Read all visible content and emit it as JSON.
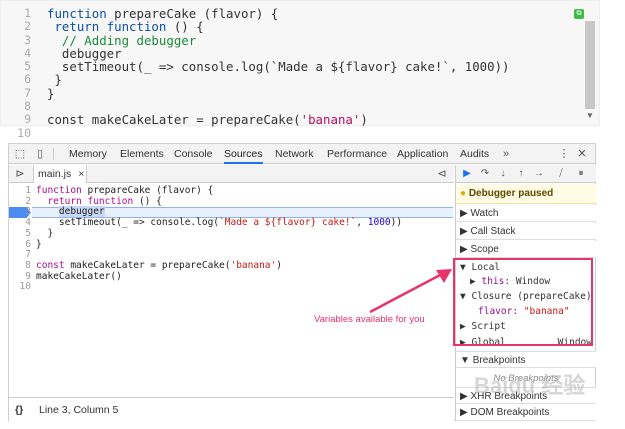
{
  "snippet": {
    "line_numbers": [
      "1",
      "2",
      "3",
      "4",
      "5",
      "6",
      "7",
      "8",
      "9",
      "10"
    ],
    "lines": [
      [
        [
          "kw",
          "function "
        ],
        [
          "tx",
          "prepareCake (flavor) {"
        ]
      ],
      [
        [
          "kw",
          " return function "
        ],
        [
          "tx",
          "() {"
        ]
      ],
      [
        [
          "cm",
          "  // Adding debugger"
        ]
      ],
      [
        [
          "tx",
          "  debugger"
        ]
      ],
      [
        [
          "tx",
          "  setTimeout(_ => console.log(`Made a ${flavor} cake!`, 1000))"
        ]
      ],
      [
        [
          "tx",
          " }"
        ]
      ],
      [
        [
          "tx",
          "}"
        ]
      ],
      [
        [
          "tx",
          ""
        ]
      ],
      [
        [
          "tx",
          "const makeCakeLater = prepareCake("
        ],
        [
          "str",
          "'banana'"
        ],
        [
          "tx",
          ")"
        ]
      ],
      [
        [
          "tx",
          ""
        ]
      ]
    ]
  },
  "toolbar": {
    "tabs": [
      "Memory",
      "Elements",
      "Console",
      "Sources",
      "Network",
      "Performance",
      "Application",
      "Audits"
    ],
    "active_tab": "Sources",
    "more": "»",
    "menu": "⋮",
    "close": "✕"
  },
  "sources": {
    "file_tab": "main.js",
    "file_close": "×",
    "editor_lines": [
      "1",
      "2",
      "3",
      "4",
      "5",
      "6",
      "7",
      "8",
      "9",
      "10"
    ],
    "code": [
      [
        [
          "kw",
          "function "
        ],
        [
          "tx",
          "prepareCake (flavor) {"
        ]
      ],
      [
        [
          "kw",
          "  return function "
        ],
        [
          "tx",
          "() {"
        ]
      ],
      [
        [
          "tx",
          "    debugger"
        ]
      ],
      [
        [
          "tx",
          "    setTimeout(_ => console.log("
        ],
        [
          "str",
          "`Made a ${flavor} cake!`"
        ],
        [
          "tx",
          ", "
        ],
        [
          "num",
          "1000"
        ],
        [
          "tx",
          "))"
        ]
      ],
      [
        [
          "tx",
          "  }"
        ]
      ],
      [
        [
          "tx",
          "}"
        ]
      ],
      [
        [
          "tx",
          ""
        ]
      ],
      [
        [
          "kw",
          "const "
        ],
        [
          "tx",
          "makeCakeLater = prepareCake("
        ],
        [
          "str",
          "'banana'"
        ],
        [
          "tx",
          ")"
        ]
      ],
      [
        [
          "tx",
          "makeCakeLater()"
        ]
      ],
      [
        [
          "tx",
          ""
        ]
      ]
    ],
    "status": "Line 3, Column 5",
    "status_icon": "{}"
  },
  "debugger": {
    "paused": "Debugger paused",
    "watch": "Watch",
    "call_stack": "Call Stack",
    "scope": "Scope",
    "local": "Local",
    "this_key": "this:",
    "this_val": "Window",
    "closure": "Closure (prepareCake)",
    "flavor_key": "flavor:",
    "flavor_val": "\"banana\"",
    "script": "Script",
    "global": "Global",
    "global_val": "Window",
    "breakpoints": "Breakpoints",
    "no_breakpoints": "No Breakpoints",
    "xhr": "XHR Breakpoints",
    "dom": "DOM Breakpoints"
  },
  "annotation": {
    "callout": "Variables available for you"
  },
  "watermark": "Baidu 经验",
  "colors": {
    "accent": "#1a73e8",
    "highlight": "#e8336b",
    "paused_banner": "#fffbe5"
  }
}
